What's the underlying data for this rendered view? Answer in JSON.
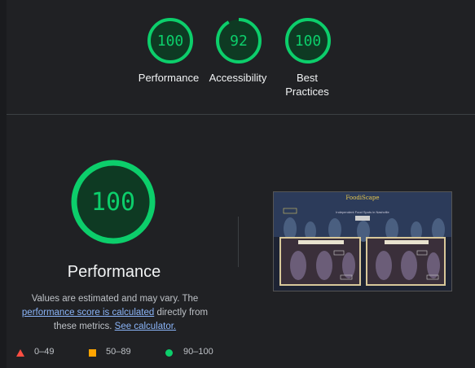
{
  "summary": {
    "gauges": [
      {
        "score": "100",
        "label": "Performance",
        "value": 100
      },
      {
        "score": "92",
        "label": "Accessibility",
        "value": 92
      },
      {
        "score": "100",
        "label": "Best Practices",
        "value": 100
      }
    ]
  },
  "detail": {
    "score": "100",
    "value": 100,
    "title": "Performance",
    "desc_prefix": "Values are estimated and may vary. The ",
    "desc_link1": "performance score is calculated",
    "desc_middle": " directly from these metrics. ",
    "desc_link2": "See calculator."
  },
  "legend": [
    {
      "range": "0–49",
      "color": "#ff4e42",
      "icon": "triangle-icon"
    },
    {
      "range": "50–89",
      "color": "#ffa400",
      "icon": "square-icon"
    },
    {
      "range": "90–100",
      "color": "#0cce6b",
      "icon": "circle-icon"
    }
  ],
  "screenshot": {
    "title": "FoodiScape",
    "subtitle": "Independent Food Spots in Nashville",
    "cards": [
      {
        "title": "Restaurants"
      },
      {
        "title": "Bars"
      }
    ]
  },
  "colors": {
    "pass": "#0cce6b",
    "pass_bg": "#0e3a23",
    "bg": "#202124"
  }
}
